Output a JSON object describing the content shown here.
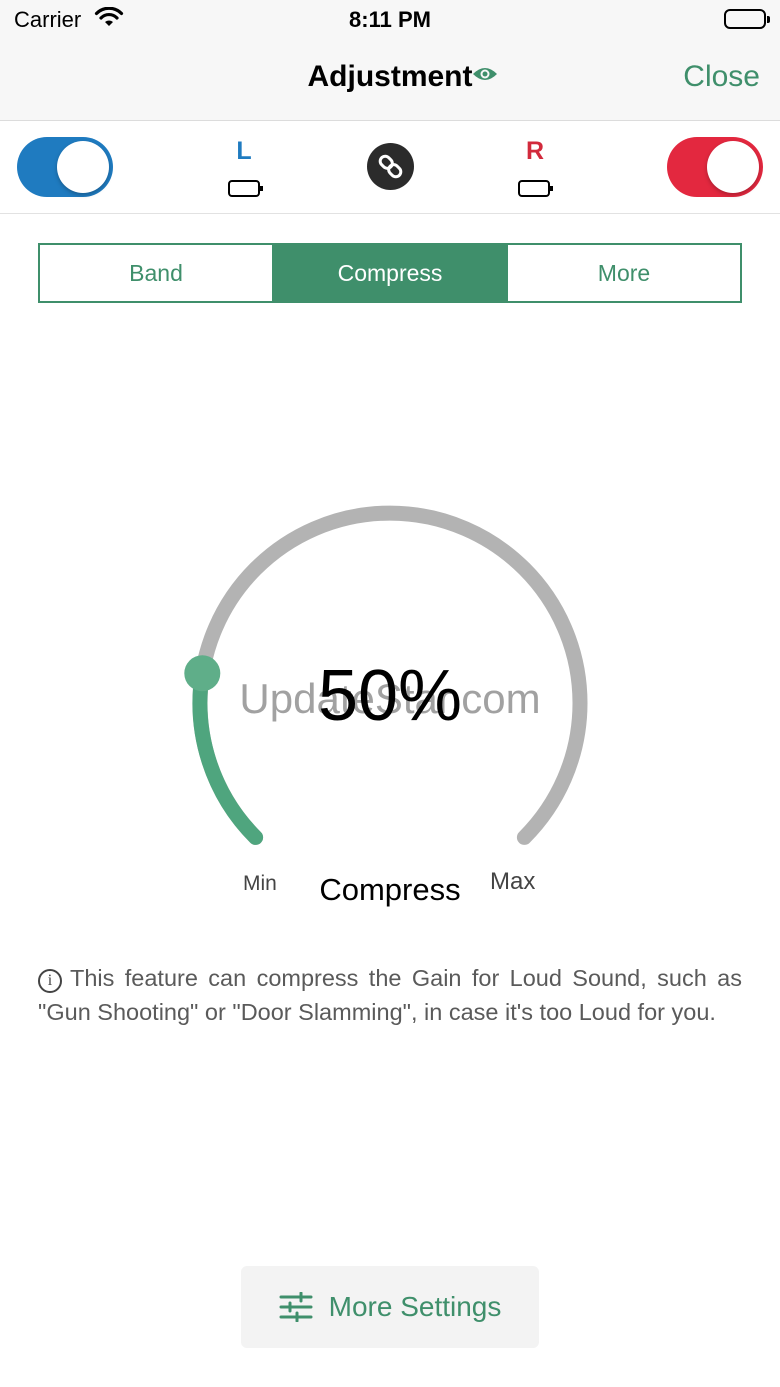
{
  "status_bar": {
    "carrier": "Carrier",
    "time": "8:11 PM",
    "icons": [
      "wifi-icon",
      "battery-icon"
    ]
  },
  "nav": {
    "title": "Adjustment",
    "title_icon": "eye-icon",
    "close_label": "Close"
  },
  "sides": {
    "left": {
      "label": "L",
      "enabled": true,
      "color": "#1f7bc0"
    },
    "right": {
      "label": "R",
      "enabled": true,
      "color": "#e3283f"
    },
    "link_icon": "link-icon"
  },
  "tabs": [
    {
      "label": "Band",
      "active": false
    },
    {
      "label": "Compress",
      "active": true
    },
    {
      "label": "More",
      "active": false
    }
  ],
  "dial": {
    "value": "50%",
    "level": 0.5,
    "caption": "Compress",
    "min_label": "Min",
    "max_label": "Max",
    "watermark": "UpdateStar.com"
  },
  "info": {
    "icon": "info-icon",
    "text": "This feature can compress the Gain for Loud Sound, such as \"Gun Shooting\" or \"Door Slamming\", in case it's too Loud for you."
  },
  "bottom_button": {
    "icon": "sliders-icon",
    "label": "More Settings"
  },
  "colors": {
    "accent": "#3f8f6b",
    "track": "#b3b3b3",
    "left": "#1f7bc0",
    "right": "#e3283f"
  }
}
